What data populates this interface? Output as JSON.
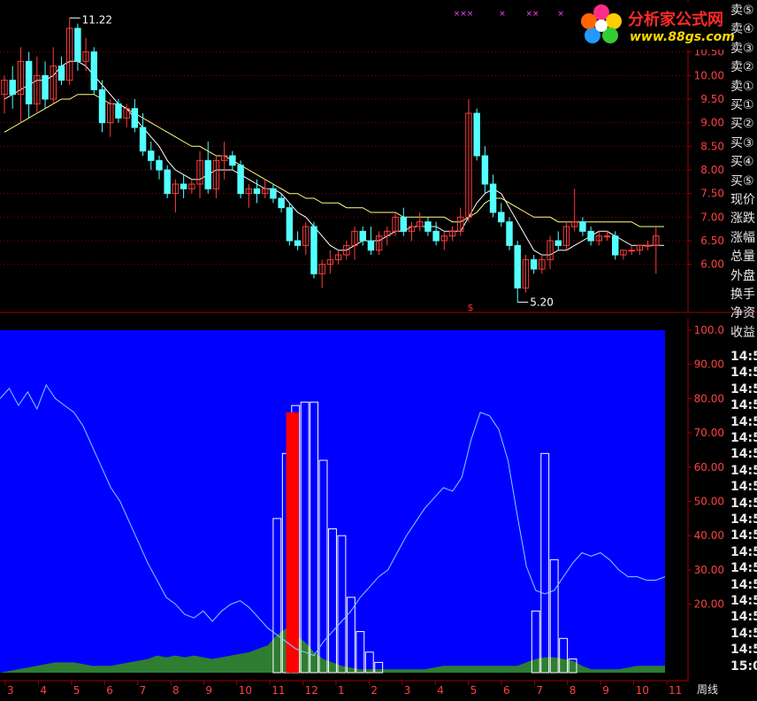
{
  "logo": {
    "name": "分析家公式网",
    "url": "www.88gs.com"
  },
  "period_label": "周线",
  "side_panel": {
    "items": [
      "卖⑤",
      "卖④",
      "卖③",
      "卖②",
      "卖①",
      "买①",
      "买②",
      "买③",
      "买④",
      "买⑤",
      "现价",
      "涨跌",
      "涨幅",
      "总量",
      "外盘",
      "换手",
      "净资",
      "收益"
    ],
    "times": [
      "14:5",
      "14:5",
      "14:5",
      "14:5",
      "14:5",
      "14:5",
      "14:5",
      "14:5",
      "14:5",
      "14:5",
      "14:5",
      "14:5",
      "14:5",
      "14:5",
      "14:5",
      "14:5",
      "14:5",
      "14:5",
      "14:5",
      "15:0"
    ]
  },
  "chart_data": [
    {
      "type": "candlestick",
      "price_axis": {
        "ylim": [
          5.0,
          11.6
        ],
        "ticks": [
          "6.00",
          "6.50",
          "7.00",
          "7.50",
          "8.00",
          "8.50",
          "9.00",
          "9.50",
          "10.00",
          "10.50"
        ]
      },
      "annotations": {
        "high_label": "11.22",
        "low_label": "5.20",
        "top_markers": [
          "×××",
          "×",
          "××",
          "×"
        ],
        "signal_marker": "$"
      },
      "colors": {
        "up": "#ff3c3c",
        "down": "#54ffff",
        "ma_short": "#ffffff",
        "ma_long": "#ffff80",
        "grid": "#8b0000"
      },
      "candles": [
        {
          "o": 9.6,
          "h": 10.0,
          "l": 9.2,
          "c": 9.9
        },
        {
          "o": 9.9,
          "h": 10.2,
          "l": 9.3,
          "c": 9.6
        },
        {
          "o": 9.6,
          "h": 10.6,
          "l": 9.0,
          "c": 10.3
        },
        {
          "o": 10.3,
          "h": 10.5,
          "l": 9.1,
          "c": 9.4
        },
        {
          "o": 9.4,
          "h": 10.4,
          "l": 9.2,
          "c": 10.0
        },
        {
          "o": 10.0,
          "h": 10.3,
          "l": 9.3,
          "c": 9.5
        },
        {
          "o": 9.5,
          "h": 10.6,
          "l": 9.4,
          "c": 10.2
        },
        {
          "o": 10.2,
          "h": 10.4,
          "l": 9.8,
          "c": 9.9
        },
        {
          "o": 9.9,
          "h": 11.22,
          "l": 9.8,
          "c": 11.0
        },
        {
          "o": 11.0,
          "h": 11.1,
          "l": 10.1,
          "c": 10.3
        },
        {
          "o": 10.3,
          "h": 10.8,
          "l": 10.1,
          "c": 10.5
        },
        {
          "o": 10.5,
          "h": 10.6,
          "l": 9.6,
          "c": 9.7
        },
        {
          "o": 9.7,
          "h": 9.9,
          "l": 8.8,
          "c": 9.0
        },
        {
          "o": 9.0,
          "h": 9.5,
          "l": 8.7,
          "c": 9.4
        },
        {
          "o": 9.4,
          "h": 9.5,
          "l": 9.0,
          "c": 9.1
        },
        {
          "o": 9.1,
          "h": 9.4,
          "l": 8.9,
          "c": 9.3
        },
        {
          "o": 9.3,
          "h": 9.5,
          "l": 8.8,
          "c": 8.9
        },
        {
          "o": 8.9,
          "h": 9.2,
          "l": 8.3,
          "c": 8.4
        },
        {
          "o": 8.4,
          "h": 8.6,
          "l": 8.0,
          "c": 8.2
        },
        {
          "o": 8.2,
          "h": 8.3,
          "l": 7.8,
          "c": 8.0
        },
        {
          "o": 8.0,
          "h": 8.1,
          "l": 7.4,
          "c": 7.5
        },
        {
          "o": 7.5,
          "h": 7.8,
          "l": 7.1,
          "c": 7.7
        },
        {
          "o": 7.7,
          "h": 7.9,
          "l": 7.4,
          "c": 7.6
        },
        {
          "o": 7.6,
          "h": 7.8,
          "l": 7.5,
          "c": 7.7
        },
        {
          "o": 7.7,
          "h": 8.4,
          "l": 7.4,
          "c": 8.2
        },
        {
          "o": 8.2,
          "h": 8.6,
          "l": 7.5,
          "c": 7.6
        },
        {
          "o": 7.6,
          "h": 8.3,
          "l": 7.4,
          "c": 8.2
        },
        {
          "o": 8.2,
          "h": 8.6,
          "l": 7.8,
          "c": 8.3
        },
        {
          "o": 8.3,
          "h": 8.4,
          "l": 8.0,
          "c": 8.1
        },
        {
          "o": 8.1,
          "h": 8.2,
          "l": 7.4,
          "c": 7.5
        },
        {
          "o": 7.5,
          "h": 7.7,
          "l": 7.2,
          "c": 7.6
        },
        {
          "o": 7.6,
          "h": 7.8,
          "l": 7.3,
          "c": 7.5
        },
        {
          "o": 7.5,
          "h": 7.8,
          "l": 7.4,
          "c": 7.6
        },
        {
          "o": 7.6,
          "h": 7.7,
          "l": 7.3,
          "c": 7.4
        },
        {
          "o": 7.4,
          "h": 7.5,
          "l": 7.1,
          "c": 7.2
        },
        {
          "o": 7.2,
          "h": 7.3,
          "l": 6.4,
          "c": 6.5
        },
        {
          "o": 6.5,
          "h": 6.7,
          "l": 6.3,
          "c": 6.4
        },
        {
          "o": 6.4,
          "h": 6.9,
          "l": 6.2,
          "c": 6.8
        },
        {
          "o": 6.8,
          "h": 6.9,
          "l": 5.7,
          "c": 5.8
        },
        {
          "o": 5.8,
          "h": 6.1,
          "l": 5.5,
          "c": 6.0
        },
        {
          "o": 6.0,
          "h": 6.3,
          "l": 5.8,
          "c": 6.1
        },
        {
          "o": 6.1,
          "h": 6.3,
          "l": 6.0,
          "c": 6.2
        },
        {
          "o": 6.2,
          "h": 6.5,
          "l": 6.1,
          "c": 6.4
        },
        {
          "o": 6.4,
          "h": 6.8,
          "l": 6.1,
          "c": 6.7
        },
        {
          "o": 6.7,
          "h": 6.8,
          "l": 6.4,
          "c": 6.5
        },
        {
          "o": 6.5,
          "h": 6.8,
          "l": 6.2,
          "c": 6.3
        },
        {
          "o": 6.3,
          "h": 6.7,
          "l": 6.2,
          "c": 6.6
        },
        {
          "o": 6.6,
          "h": 6.8,
          "l": 6.4,
          "c": 6.7
        },
        {
          "o": 6.7,
          "h": 7.1,
          "l": 6.6,
          "c": 7.0
        },
        {
          "o": 7.0,
          "h": 7.2,
          "l": 6.6,
          "c": 6.7
        },
        {
          "o": 6.7,
          "h": 6.9,
          "l": 6.5,
          "c": 6.8
        },
        {
          "o": 6.8,
          "h": 7.1,
          "l": 6.7,
          "c": 6.9
        },
        {
          "o": 6.9,
          "h": 7.0,
          "l": 6.6,
          "c": 6.7
        },
        {
          "o": 6.7,
          "h": 6.9,
          "l": 6.4,
          "c": 6.5
        },
        {
          "o": 6.5,
          "h": 6.7,
          "l": 6.3,
          "c": 6.6
        },
        {
          "o": 6.6,
          "h": 6.8,
          "l": 6.5,
          "c": 6.7
        },
        {
          "o": 6.7,
          "h": 7.2,
          "l": 6.6,
          "c": 7.0
        },
        {
          "o": 7.0,
          "h": 9.5,
          "l": 6.9,
          "c": 9.2
        },
        {
          "o": 9.2,
          "h": 9.3,
          "l": 8.2,
          "c": 8.3
        },
        {
          "o": 8.3,
          "h": 8.5,
          "l": 7.5,
          "c": 7.7
        },
        {
          "o": 7.7,
          "h": 7.9,
          "l": 7.0,
          "c": 7.1
        },
        {
          "o": 7.1,
          "h": 7.3,
          "l": 6.8,
          "c": 6.9
        },
        {
          "o": 6.9,
          "h": 7.0,
          "l": 6.3,
          "c": 6.4
        },
        {
          "o": 6.4,
          "h": 6.5,
          "l": 5.2,
          "c": 5.5
        },
        {
          "o": 5.5,
          "h": 6.2,
          "l": 5.4,
          "c": 6.1
        },
        {
          "o": 6.1,
          "h": 6.2,
          "l": 5.8,
          "c": 5.9
        },
        {
          "o": 5.9,
          "h": 6.2,
          "l": 5.8,
          "c": 6.1
        },
        {
          "o": 6.1,
          "h": 6.6,
          "l": 5.9,
          "c": 6.5
        },
        {
          "o": 6.5,
          "h": 6.7,
          "l": 6.3,
          "c": 6.4
        },
        {
          "o": 6.4,
          "h": 6.9,
          "l": 6.3,
          "c": 6.8
        },
        {
          "o": 6.8,
          "h": 7.6,
          "l": 6.7,
          "c": 6.9
        },
        {
          "o": 6.9,
          "h": 7.0,
          "l": 6.6,
          "c": 6.7
        },
        {
          "o": 6.7,
          "h": 6.8,
          "l": 6.4,
          "c": 6.5
        },
        {
          "o": 6.5,
          "h": 6.7,
          "l": 6.4,
          "c": 6.6
        },
        {
          "o": 6.6,
          "h": 6.7,
          "l": 6.5,
          "c": 6.6
        },
        {
          "o": 6.6,
          "h": 6.7,
          "l": 6.1,
          "c": 6.2
        },
        {
          "o": 6.2,
          "h": 6.3,
          "l": 6.1,
          "c": 6.3
        },
        {
          "o": 6.3,
          "h": 6.4,
          "l": 6.2,
          "c": 6.3
        },
        {
          "o": 6.3,
          "h": 6.4,
          "l": 6.2,
          "c": 6.4
        },
        {
          "o": 6.4,
          "h": 6.5,
          "l": 6.3,
          "c": 6.4
        },
        {
          "o": 6.4,
          "h": 6.8,
          "l": 5.8,
          "c": 6.6
        }
      ],
      "ma_short": [
        9.5,
        9.6,
        9.7,
        9.8,
        9.9,
        9.9,
        10.0,
        10.2,
        10.3,
        10.3,
        10.2,
        10.0,
        9.8,
        9.6,
        9.4,
        9.3,
        9.1,
        8.9,
        8.7,
        8.5,
        8.2,
        8.0,
        7.9,
        7.8,
        7.8,
        7.9,
        8.0,
        8.0,
        8.0,
        7.9,
        7.8,
        7.7,
        7.6,
        7.6,
        7.5,
        7.3,
        7.1,
        7.0,
        6.8,
        6.6,
        6.4,
        6.3,
        6.3,
        6.4,
        6.5,
        6.5,
        6.5,
        6.6,
        6.7,
        6.7,
        6.8,
        6.8,
        6.8,
        6.8,
        6.7,
        6.7,
        6.7,
        7.0,
        7.3,
        7.5,
        7.6,
        7.5,
        7.2,
        6.9,
        6.6,
        6.3,
        6.2,
        6.2,
        6.3,
        6.3,
        6.4,
        6.5,
        6.6,
        6.7,
        6.7,
        6.6,
        6.5,
        6.4,
        6.4,
        6.4,
        6.4,
        6.4
      ],
      "ma_long": [
        8.8,
        8.9,
        9.0,
        9.1,
        9.2,
        9.3,
        9.4,
        9.5,
        9.5,
        9.6,
        9.6,
        9.6,
        9.5,
        9.4,
        9.4,
        9.3,
        9.2,
        9.1,
        9.0,
        8.9,
        8.8,
        8.7,
        8.6,
        8.5,
        8.5,
        8.4,
        8.3,
        8.3,
        8.2,
        8.1,
        8.0,
        7.9,
        7.8,
        7.7,
        7.6,
        7.5,
        7.5,
        7.4,
        7.4,
        7.3,
        7.3,
        7.3,
        7.2,
        7.2,
        7.2,
        7.1,
        7.1,
        7.1,
        7.1,
        7.0,
        7.0,
        7.0,
        7.0,
        7.0,
        7.0,
        6.9,
        6.9,
        7.0,
        7.1,
        7.3,
        7.4,
        7.4,
        7.3,
        7.2,
        7.1,
        7.0,
        7.0,
        7.0,
        6.9,
        6.9,
        6.9,
        6.9,
        6.9,
        6.9,
        6.9,
        6.9,
        6.9,
        6.9,
        6.8,
        6.8,
        6.8,
        6.8
      ]
    },
    {
      "type": "indicator",
      "ylim": [
        0,
        100
      ],
      "ticks": [
        "20.00",
        "30.00",
        "40.00",
        "50.00",
        "60.00",
        "70.00",
        "80.00",
        "90.00",
        "100.0"
      ],
      "x_tick_labels": [
        "3",
        "4",
        "5",
        "6",
        "7",
        "8",
        "9",
        "10",
        "11",
        "12",
        "1",
        "2",
        "3",
        "4",
        "5",
        "6",
        "7",
        "8",
        "9",
        "10",
        "11"
      ],
      "colors": {
        "background": "#0000ff",
        "line": "#7fd4ff",
        "area": "#2e7d32",
        "bars": "#ffffff",
        "highlight": "#ff0000"
      },
      "line": [
        80,
        83,
        78,
        82,
        77,
        84,
        80,
        78,
        76,
        72,
        66,
        60,
        54,
        50,
        44,
        38,
        32,
        27,
        22,
        20,
        17,
        16,
        18,
        15,
        18,
        20,
        21,
        19,
        16,
        13,
        11,
        9,
        7,
        6,
        5,
        9,
        12,
        15,
        18,
        22,
        25,
        28,
        30,
        35,
        40,
        44,
        48,
        51,
        54,
        53,
        57,
        68,
        76,
        75,
        71,
        62,
        46,
        31,
        24,
        23,
        24,
        28,
        32,
        35,
        34,
        35,
        33,
        30,
        28,
        28,
        27,
        27,
        28
      ],
      "area": [
        0,
        0.5,
        1,
        1.5,
        2,
        2.5,
        3,
        3,
        3,
        2.5,
        2,
        2,
        2,
        2.5,
        3,
        3.5,
        4,
        5,
        4.5,
        5,
        4.5,
        5,
        4.5,
        4,
        4.5,
        5,
        5.5,
        6,
        7,
        8,
        11,
        13,
        11,
        9,
        6,
        4,
        3,
        2,
        1.5,
        1,
        1,
        1,
        1,
        1,
        1,
        1,
        1,
        1.5,
        2,
        2,
        2,
        2,
        2,
        2,
        2,
        2,
        2,
        3,
        4,
        4.5,
        4.5,
        4,
        3.5,
        2,
        1,
        1,
        1,
        1,
        1.5,
        2,
        2,
        2,
        2
      ],
      "bars": [
        {
          "i": 30,
          "v": 45
        },
        {
          "i": 31,
          "v": 64
        },
        {
          "i": 32,
          "v": 78
        },
        {
          "i": 33,
          "v": 79
        },
        {
          "i": 34,
          "v": 79
        },
        {
          "i": 35,
          "v": 62
        },
        {
          "i": 36,
          "v": 42
        },
        {
          "i": 37,
          "v": 40
        },
        {
          "i": 38,
          "v": 22
        },
        {
          "i": 39,
          "v": 12
        },
        {
          "i": 40,
          "v": 6
        },
        {
          "i": 41,
          "v": 3
        },
        {
          "i": 58,
          "v": 18
        },
        {
          "i": 59,
          "v": 64
        },
        {
          "i": 60,
          "v": 33
        },
        {
          "i": 61,
          "v": 10
        },
        {
          "i": 62,
          "v": 4
        }
      ],
      "highlight_bar": {
        "i": 32,
        "v": 76
      }
    }
  ]
}
